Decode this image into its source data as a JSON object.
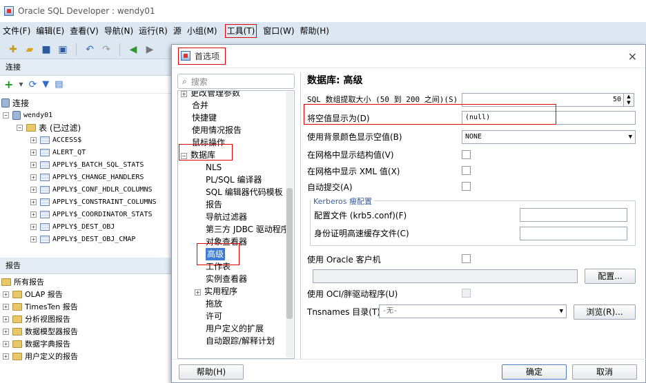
{
  "window": {
    "title": "Oracle SQL Developer : wendy01"
  },
  "menu": [
    "文件(F)",
    "编辑(E)",
    "查看(V)",
    "导航(N)",
    "运行(R)",
    "源",
    "小组(M)",
    "工具(T)",
    "窗口(W)",
    "帮助(H)"
  ],
  "connections": {
    "panel_title": "连接",
    "root_label": "连接",
    "connection_name": "wendy01",
    "tables_folder": "表 (已过滤)",
    "tables": [
      "ACCESS$",
      "ALERT_QT",
      "APPLY$_BATCH_SQL_STATS",
      "APPLY$_CHANGE_HANDLERS",
      "APPLY$_CONF_HDLR_COLUMNS",
      "APPLY$_CONSTRAINT_COLUMNS",
      "APPLY$_COORDINATOR_STATS",
      "APPLY$_DEST_OBJ",
      "APPLY$_DEST_OBJ_CMAP"
    ]
  },
  "reports": {
    "panel_title": "报告",
    "root": "所有报告",
    "items": [
      "OLAP 报告",
      "TimesTen 报告",
      "分析视图报告",
      "数据模型器报告",
      "数据字典报告",
      "用户定义的报告"
    ]
  },
  "dialog": {
    "title": "首选项",
    "search_placeholder": "搜索",
    "tree_top": [
      "更改管理参数",
      "合并",
      "快捷键",
      "使用情况报告",
      "鼠标操作"
    ],
    "tree_db": "数据库",
    "tree_children": [
      "NLS",
      "PL/SQL 编译器",
      "SQL 编辑器代码模板",
      "报告",
      "导航过滤器",
      "第三方 JDBC 驱动程序",
      "对象查看器",
      "高级",
      "工作表",
      "实例查看器",
      "实用程序",
      "拖放",
      "许可",
      "用户定义的扩展",
      "自动跟踪/解释计划"
    ],
    "selected": "高级",
    "page_heading": "数据库: 高级",
    "fetch_label": "SQL 数组提取大小 (50 到 200 之间)(S)",
    "fetch_value": "50",
    "null_label": "将空值显示为(D)",
    "null_value": "(null)",
    "bg_label": "使用背景颜色显示空值(B)",
    "bg_value": "NONE",
    "struct_label": "在网格中显示结构值(V)",
    "xml_label": "在网格中显示 XML 值(X)",
    "autocommit_label": "自动提交(A)",
    "kerberos_title": "Kerberos 瘦配置",
    "config_file_label": "配置文件 (krb5.conf)(F)",
    "cache_label": "身份证明高速缓存文件(C)",
    "oracle_client_label": "使用 Oracle 客户机",
    "config_button": "配置...",
    "oci_label": "使用 OCI/胖驱动程序(U)",
    "tns_label": "Tnsnames 目录(T)",
    "tns_value": "-无-",
    "browse_button": "浏览(R)...",
    "help_button": "帮助(H)",
    "ok_button": "确定",
    "cancel_button": "取消"
  }
}
